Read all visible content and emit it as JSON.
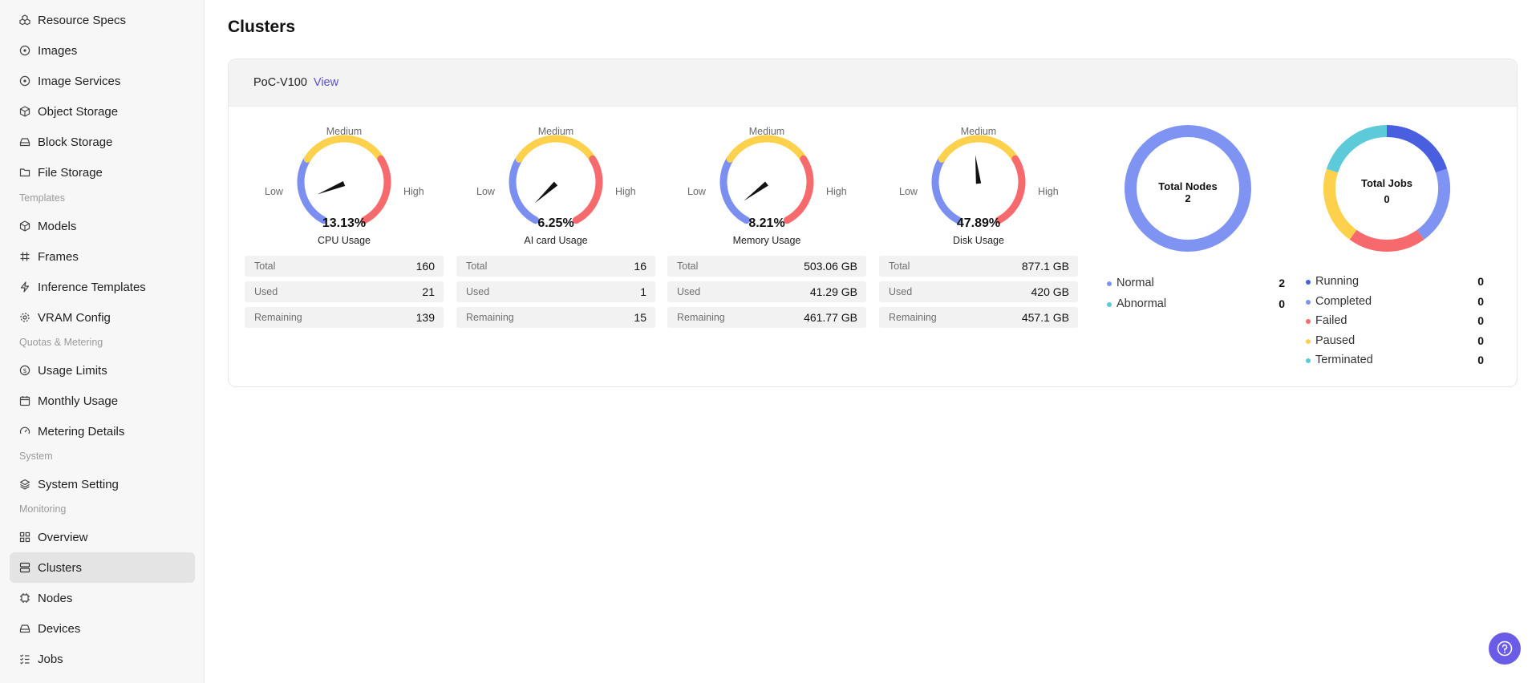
{
  "sidebar": {
    "items_top": [
      {
        "label": "Resource Specs",
        "icon": "cubes-icon"
      },
      {
        "label": "Images",
        "icon": "image-icon"
      },
      {
        "label": "Image Services",
        "icon": "image-service-icon"
      },
      {
        "label": "Object Storage",
        "icon": "box-icon"
      },
      {
        "label": "Block Storage",
        "icon": "hard-drive-icon"
      },
      {
        "label": "File Storage",
        "icon": "folder-icon"
      }
    ],
    "section_templates": "Templates",
    "items_templates": [
      {
        "label": "Models",
        "icon": "cube-icon"
      },
      {
        "label": "Frames",
        "icon": "hash-icon"
      },
      {
        "label": "Inference Templates",
        "icon": "zap-icon"
      },
      {
        "label": "VRAM Config",
        "icon": "gear-icon"
      }
    ],
    "section_quotas": "Quotas & Metering",
    "items_quotas": [
      {
        "label": "Usage Limits",
        "icon": "dollar-circle-icon"
      },
      {
        "label": "Monthly Usage",
        "icon": "calendar-icon"
      },
      {
        "label": "Metering Details",
        "icon": "gauge-icon"
      }
    ],
    "section_system": "System",
    "items_system": [
      {
        "label": "System Setting",
        "icon": "layers-icon"
      }
    ],
    "section_monitoring": "Monitoring",
    "items_monitoring": [
      {
        "label": "Overview",
        "icon": "grid-icon"
      },
      {
        "label": "Clusters",
        "icon": "server-icon"
      },
      {
        "label": "Nodes",
        "icon": "chip-icon"
      },
      {
        "label": "Devices",
        "icon": "hard-drive-icon"
      },
      {
        "label": "Jobs",
        "icon": "list-check-icon"
      }
    ],
    "active_item": "Clusters"
  },
  "page": {
    "title": "Clusters"
  },
  "cluster": {
    "name": "PoC-V100",
    "view_label": "View"
  },
  "gauge_labels": {
    "low": "Low",
    "medium": "Medium",
    "high": "High"
  },
  "gauges": [
    {
      "name": "CPU Usage",
      "percent_text": "13.13%",
      "percent": 13.13,
      "stats": [
        {
          "label": "Total",
          "value": "160"
        },
        {
          "label": "Used",
          "value": "21"
        },
        {
          "label": "Remaining",
          "value": "139"
        }
      ]
    },
    {
      "name": "AI card Usage",
      "percent_text": "6.25%",
      "percent": 6.25,
      "stats": [
        {
          "label": "Total",
          "value": "16"
        },
        {
          "label": "Used",
          "value": "1"
        },
        {
          "label": "Remaining",
          "value": "15"
        }
      ]
    },
    {
      "name": "Memory Usage",
      "percent_text": "8.21%",
      "percent": 8.21,
      "stats": [
        {
          "label": "Total",
          "value": "503.06 GB"
        },
        {
          "label": "Used",
          "value": "41.29 GB"
        },
        {
          "label": "Remaining",
          "value": "461.77 GB"
        }
      ]
    },
    {
      "name": "Disk Usage",
      "percent_text": "47.89%",
      "percent": 47.89,
      "stats": [
        {
          "label": "Total",
          "value": "877.1 GB"
        },
        {
          "label": "Used",
          "value": "420 GB"
        },
        {
          "label": "Remaining",
          "value": "457.1 GB"
        }
      ]
    }
  ],
  "gauge_colors": {
    "low": "#7b8ff0",
    "medium": "#fdd14c",
    "high": "#f66a6e"
  },
  "nodes": {
    "title": "Total Nodes",
    "total": "2",
    "ring_color": "#7f94f2",
    "legend": [
      {
        "label": "Normal",
        "value": "2",
        "color": "#7f94f2"
      },
      {
        "label": "Abnormal",
        "value": "0",
        "color": "#5ccad8"
      }
    ]
  },
  "jobs": {
    "title": "Total Jobs",
    "total": "0",
    "legend": [
      {
        "label": "Running",
        "value": "0",
        "color": "#4a5fe0"
      },
      {
        "label": "Completed",
        "value": "0",
        "color": "#7f94f2"
      },
      {
        "label": "Failed",
        "value": "0",
        "color": "#f66a6e"
      },
      {
        "label": "Paused",
        "value": "0",
        "color": "#fdd14c"
      },
      {
        "label": "Terminated",
        "value": "0",
        "color": "#5ccad8"
      }
    ]
  },
  "help": {
    "icon": "help-circle-icon"
  }
}
